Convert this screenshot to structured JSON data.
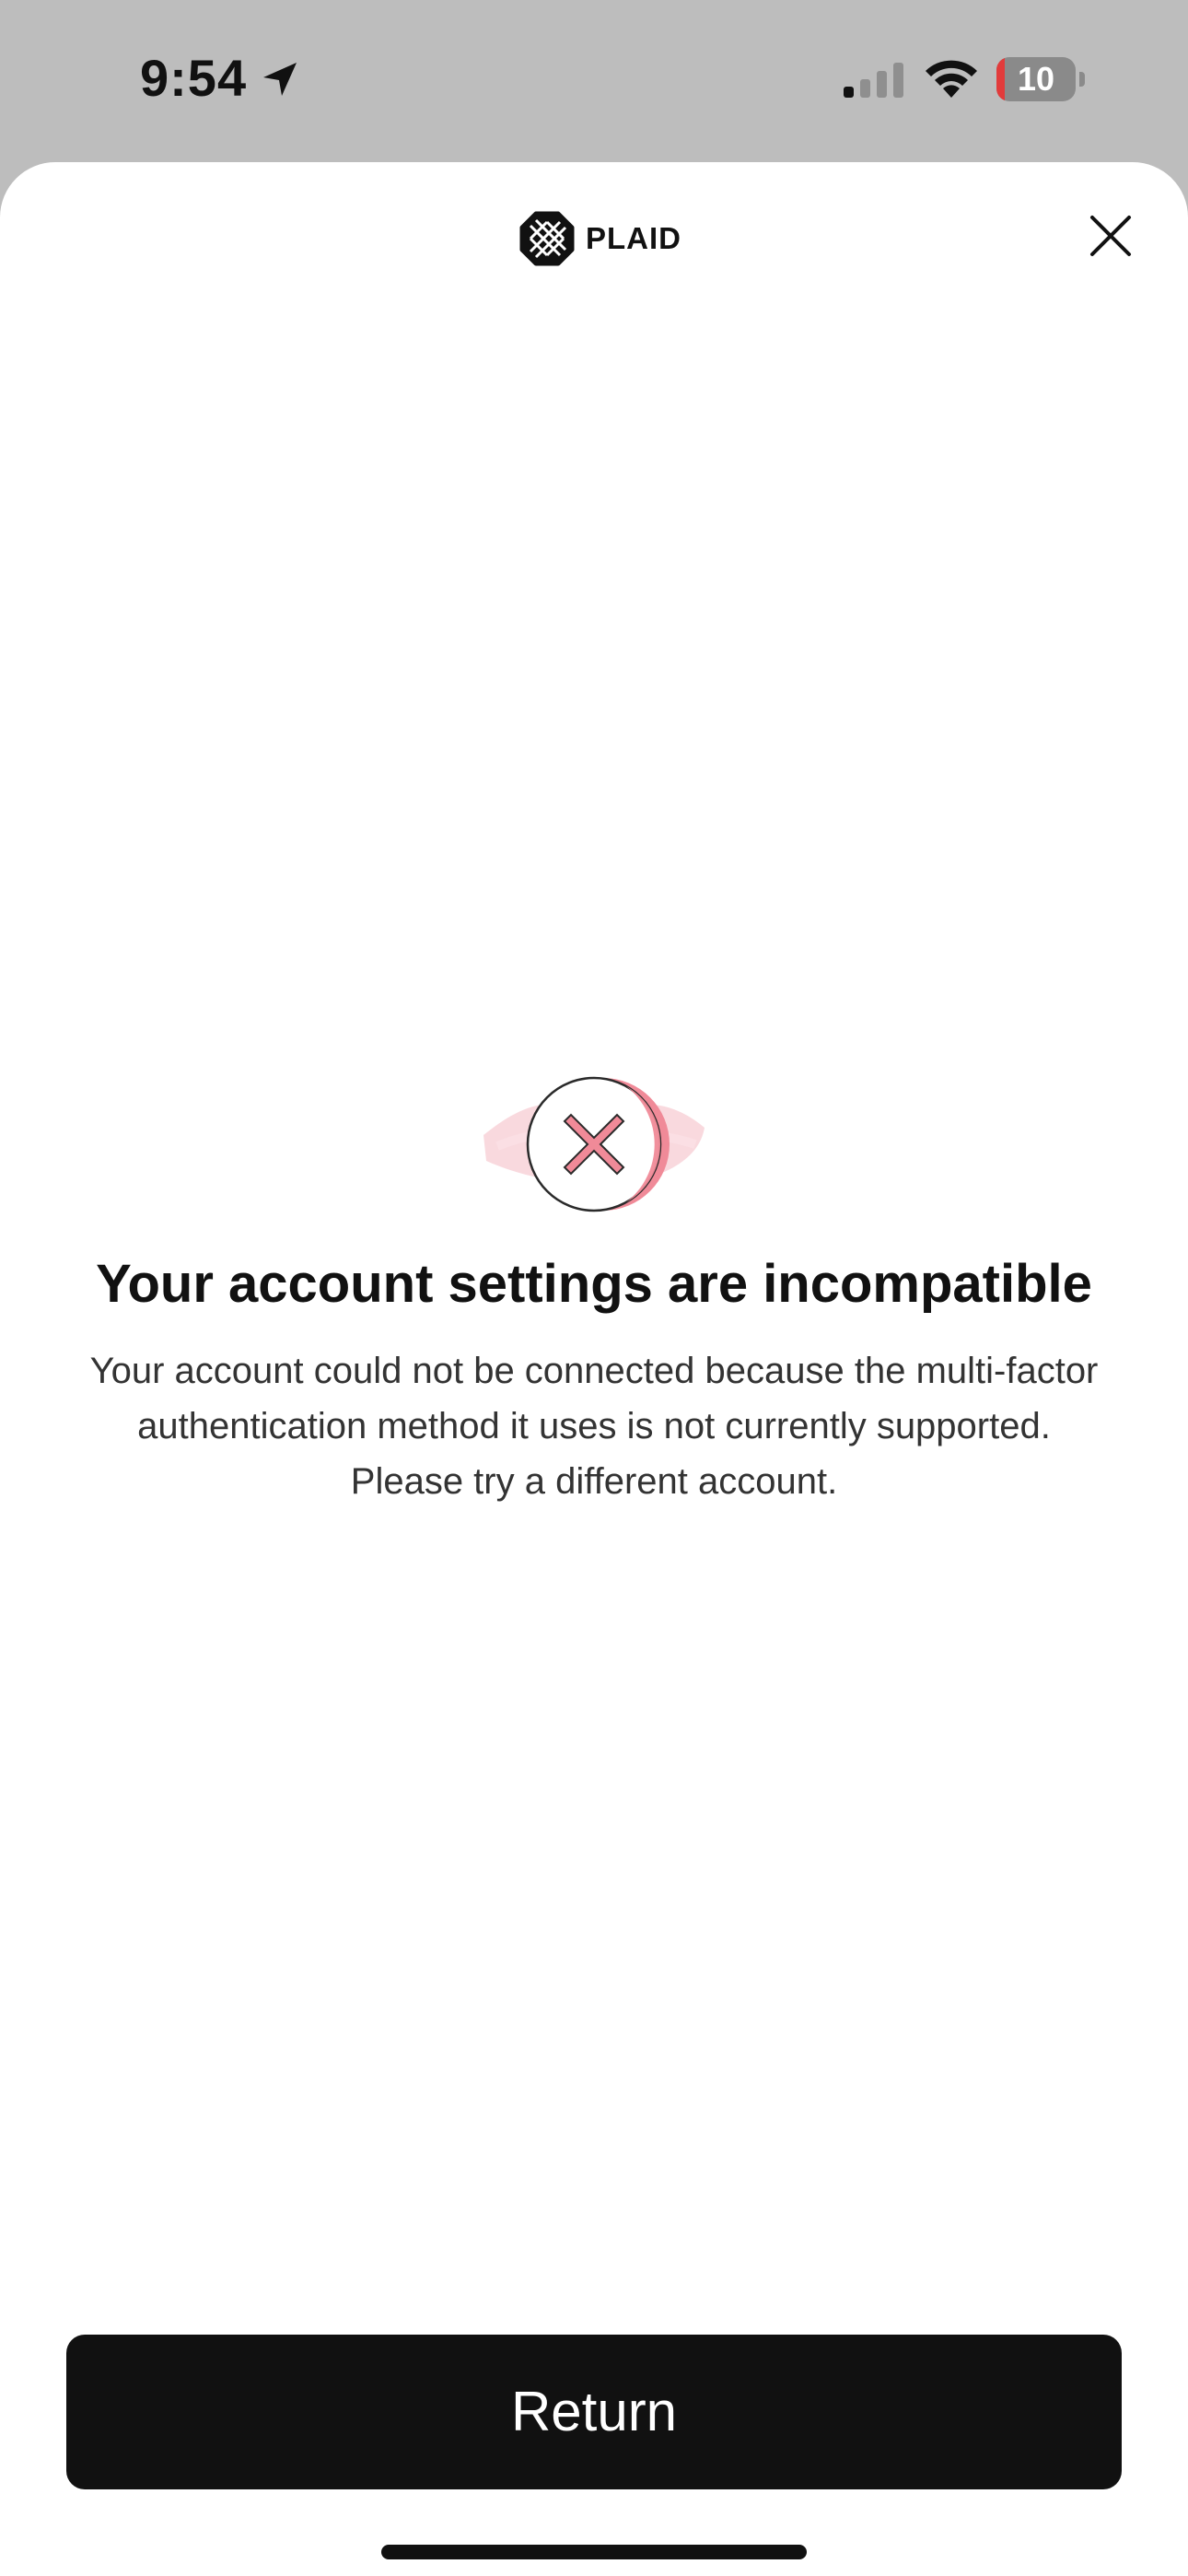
{
  "status_bar": {
    "time": "9:54",
    "battery_level": "10",
    "icons": [
      "location-arrow-icon",
      "cellular-signal-icon",
      "wifi-icon",
      "battery-icon"
    ]
  },
  "header": {
    "logo_text": "PLAID",
    "logo_icon": "plaid-logo-icon",
    "close_icon": "close-icon"
  },
  "main": {
    "error_icon": "error-x-circle-icon",
    "title": "Your account settings are incompatible",
    "description": "Your account could not be connected because the multi-factor authentication method it uses is not currently supported. Please try a different account."
  },
  "footer": {
    "return_label": "Return"
  },
  "colors": {
    "accent": "#f08a98",
    "button": "#111111",
    "battery_low": "#e23b3b"
  }
}
